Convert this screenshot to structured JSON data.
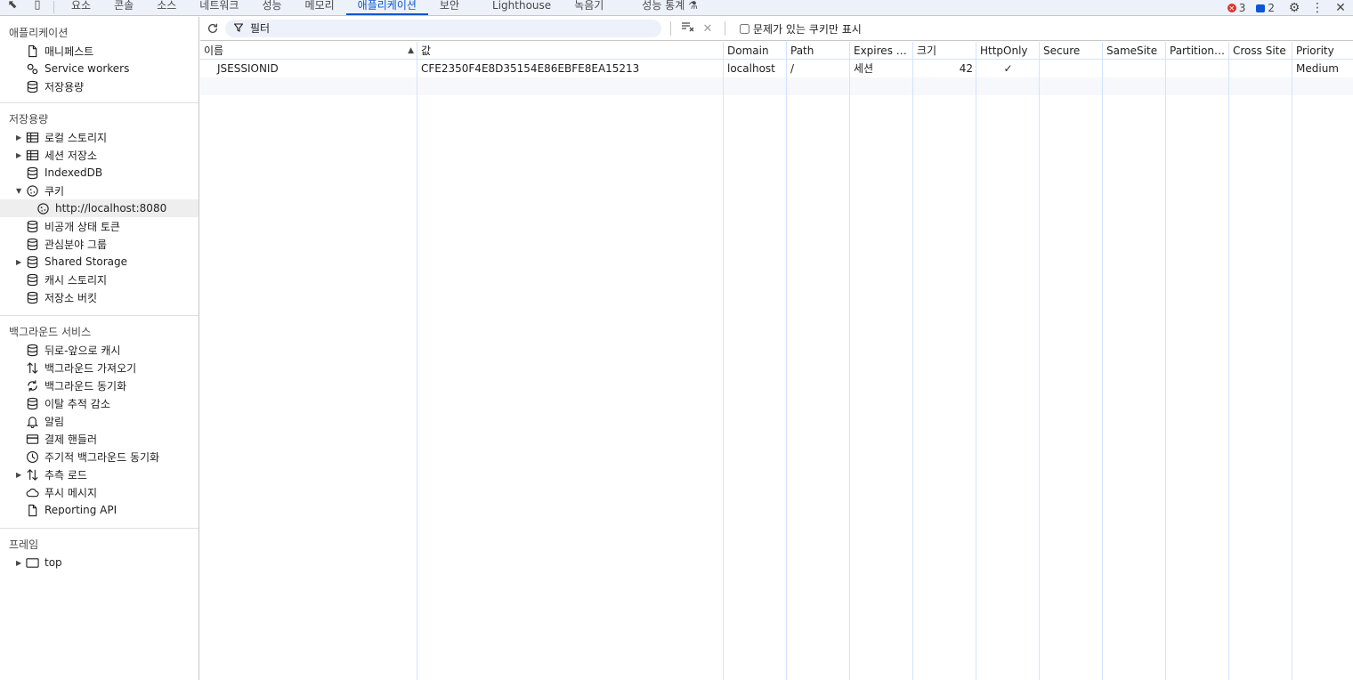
{
  "tabbar": {
    "tabs": [
      {
        "label": "요소",
        "active": false
      },
      {
        "label": "콘솔",
        "active": false
      },
      {
        "label": "소스",
        "active": false
      },
      {
        "label": "네트워크",
        "active": false
      },
      {
        "label": "성능",
        "active": false
      },
      {
        "label": "메모리",
        "active": false
      },
      {
        "label": "애플리케이션",
        "active": true
      },
      {
        "label": "보안",
        "active": false
      },
      {
        "label": "Lighthouse",
        "active": false
      },
      {
        "label": "녹음기",
        "active": false
      },
      {
        "label": "성능 통계",
        "active": false
      }
    ],
    "error_count": "3",
    "message_count": "2"
  },
  "sidebar": {
    "application": {
      "title": "애플리케이션",
      "items": [
        {
          "label": "매니페스트",
          "icon": "file-icon"
        },
        {
          "label": "Service workers",
          "icon": "gears-icon"
        },
        {
          "label": "저장용량",
          "icon": "database-icon"
        }
      ]
    },
    "storage": {
      "title": "저장용량",
      "items": [
        {
          "label": "로컬 스토리지",
          "icon": "table-icon"
        },
        {
          "label": "세션 저장소",
          "icon": "table-icon"
        },
        {
          "label": "IndexedDB",
          "icon": "database-icon"
        },
        {
          "label": "쿠키",
          "icon": "cookie-icon"
        },
        {
          "label": "http://localhost:8080",
          "icon": "cookie-icon"
        },
        {
          "label": "비공개 상태 토큰",
          "icon": "database-icon"
        },
        {
          "label": "관심분야 그룹",
          "icon": "database-icon"
        },
        {
          "label": "Shared Storage",
          "icon": "database-icon"
        },
        {
          "label": "캐시 스토리지",
          "icon": "database-icon"
        },
        {
          "label": "저장소 버킷",
          "icon": "database-icon"
        }
      ]
    },
    "background": {
      "title": "백그라운드 서비스",
      "items": [
        {
          "label": "뒤로-앞으로 캐시",
          "icon": "database-icon"
        },
        {
          "label": "백그라운드 가져오기",
          "icon": "up-down-arrows-icon"
        },
        {
          "label": "백그라운드 동기화",
          "icon": "sync-icon"
        },
        {
          "label": "이탈 추적 감소",
          "icon": "database-icon"
        },
        {
          "label": "알림",
          "icon": "bell-icon"
        },
        {
          "label": "결제 핸들러",
          "icon": "card-icon"
        },
        {
          "label": "주기적 백그라운드 동기화",
          "icon": "clock-icon"
        },
        {
          "label": "추측 로드",
          "icon": "up-down-arrows-icon"
        },
        {
          "label": "푸시 메시지",
          "icon": "cloud-icon"
        },
        {
          "label": "Reporting API",
          "icon": "file-icon"
        }
      ]
    },
    "frames": {
      "title": "프레임",
      "items": [
        {
          "label": "top",
          "icon": "frame-icon"
        }
      ]
    }
  },
  "toolbar": {
    "filter_placeholder": "필터",
    "only_issues_label": "문제가 있는 쿠키만 표시"
  },
  "table": {
    "columns": [
      "이름",
      "값",
      "Domain",
      "Path",
      "Expires / ...",
      "크기",
      "HttpOnly",
      "Secure",
      "SameSite",
      "Partition ...",
      "Cross Site",
      "Priority"
    ],
    "rows": [
      {
        "name": "JSESSIONID",
        "value": "CFE2350F4E8D35154E86EBFE8EA15213",
        "domain": "localhost",
        "path": "/",
        "expires": "세션",
        "size": "42",
        "httponly": "✓",
        "secure": "",
        "samesite": "",
        "partition": "",
        "crosssite": "",
        "priority": "Medium"
      }
    ]
  }
}
